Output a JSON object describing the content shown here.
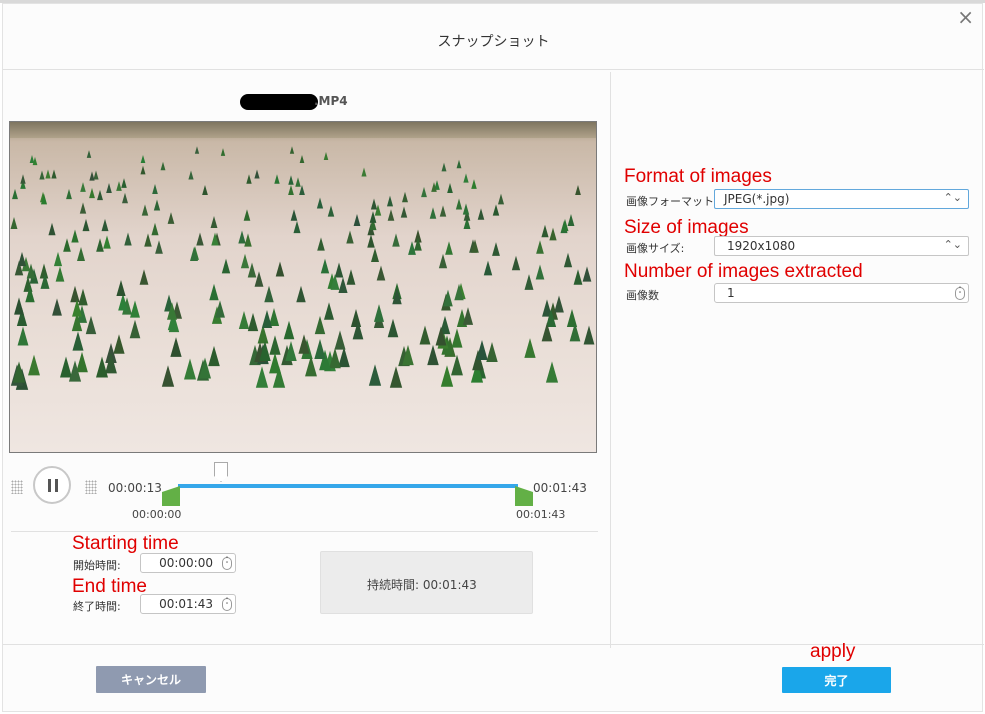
{
  "dialog": {
    "title": "スナップショット",
    "close_icon": "×"
  },
  "file": {
    "name_suffix": ".MP4"
  },
  "player": {
    "current_time": "00:00:13",
    "total_time": "00:01:43",
    "range_start_label": "00:00:00",
    "range_end_label": "00:01:43",
    "playhead_position_fraction": 0.126
  },
  "range": {
    "start_label": "開始時間:",
    "start_value": "00:00:00",
    "end_label": "終了時間:",
    "end_value": "00:01:43",
    "duration_text": "持続時間:  00:01:43"
  },
  "settings": {
    "format_label": "画像フォーマット",
    "format_value": "JPEG(*.jpg)",
    "size_label": "画像サイズ:",
    "size_value": "1920x1080",
    "count_label": "画像数",
    "count_value": "1"
  },
  "annotations": {
    "format": "Format of images",
    "size": "Size of images",
    "count": "Number of images extracted",
    "start": "Starting time",
    "end": "End time",
    "apply": "apply"
  },
  "buttons": {
    "cancel": "キャンセル",
    "ok": "完了"
  },
  "colors": {
    "accent": "#1aa6ea",
    "track": "#35a7ea",
    "handle": "#63b046",
    "annotation": "#e00000",
    "cancel": "#8f9ab0"
  }
}
